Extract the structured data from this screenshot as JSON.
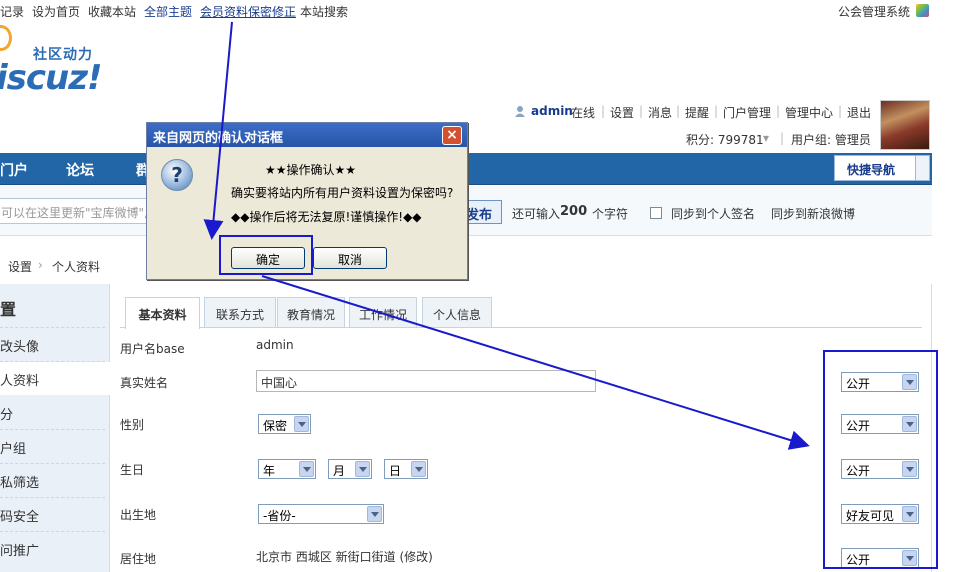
{
  "topbar": {
    "links": [
      "记录",
      "设为首页",
      "收藏本站",
      "全部主题",
      "会员资料保密修正",
      "本站搜索"
    ],
    "right_link": "公会管理系统"
  },
  "logo": {
    "slogan": "社区动力",
    "text": "iscuz!"
  },
  "user": {
    "name": "admin",
    "online": "在线",
    "links": [
      "设置",
      "消息",
      "提醒",
      "门户管理",
      "管理中心",
      "退出"
    ],
    "points_label": "积分: 799781",
    "group_label": "用户组: 管理员"
  },
  "nav": {
    "items": [
      "门户",
      "论坛",
      "群"
    ],
    "quick_nav": "快捷导航"
  },
  "status": {
    "input_placeholder": "可以在这里更新\"宝库微博\",",
    "publish_label": "发布",
    "remaining_prefix": "还可输入",
    "remaining_count": "200",
    "remaining_suffix": "个字符",
    "sync_signature": "同步到个人签名",
    "sync_weibo": "同步到新浪微博"
  },
  "breadcrumb": [
    "设置",
    "个人资料"
  ],
  "sidebar": {
    "title": "置",
    "items": [
      "改头像",
      "人资料",
      "分",
      "户组",
      "私筛选",
      "码安全",
      "问推广"
    ]
  },
  "tabs": [
    "基本资料",
    "联系方式",
    "教育情况",
    "工作情况",
    "个人信息"
  ],
  "form": {
    "username_label": "用户名base",
    "username_value": "admin",
    "realname_label": "真实姓名",
    "realname_value": "中国心",
    "gender_label": "性别",
    "gender_value": "保密",
    "birthday_label": "生日",
    "birthday_year": "年",
    "birthday_month": "月",
    "birthday_day": "日",
    "birthplace_label": "出生地",
    "birthplace_value": "-省份-",
    "residence_label": "居住地",
    "residence_value": "北京市 西城区 新街口街道 (修改)"
  },
  "privacy": [
    "公开",
    "公开",
    "公开",
    "好友可见",
    "公开"
  ],
  "dialog": {
    "title": "来自网页的确认对话框",
    "heading": "★★操作确认★★",
    "message": "确实要将站内所有用户资料设置为保密吗?",
    "warning": "◆◆操作后将无法复原!谨慎操作!◆◆",
    "ok": "确定",
    "cancel": "取消",
    "close": "×",
    "icon": "?"
  },
  "colors": {
    "accent": "#2366a8",
    "annotation": "#1a1acc"
  }
}
